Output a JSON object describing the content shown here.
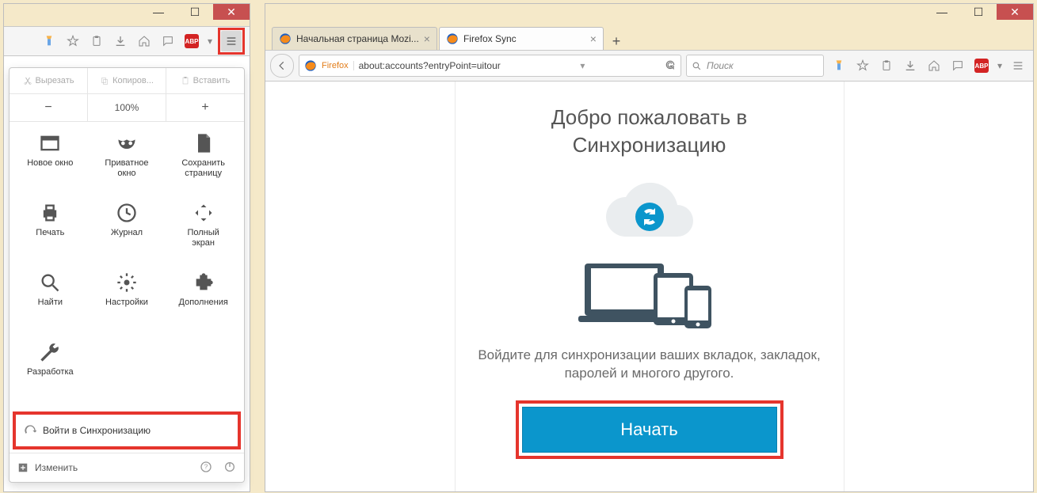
{
  "left": {
    "toolbar": {
      "abp": "ABP"
    },
    "menu": {
      "cut": "Вырезать",
      "copy": "Копиров...",
      "paste": "Вставить",
      "zoom": "100%",
      "items": [
        {
          "label": "Новое окно"
        },
        {
          "label": "Приватное\nокно"
        },
        {
          "label": "Сохранить\nстраницу"
        },
        {
          "label": "Печать"
        },
        {
          "label": "Журнал"
        },
        {
          "label": "Полный\nэкран"
        },
        {
          "label": "Найти"
        },
        {
          "label": "Настройки"
        },
        {
          "label": "Дополнения"
        },
        {
          "label": "Разработка"
        }
      ],
      "sync": "Войти в Синхронизацию",
      "customize": "Изменить"
    }
  },
  "right": {
    "tabs": [
      {
        "label": "Начальная страница Mozi..."
      },
      {
        "label": "Firefox Sync"
      }
    ],
    "url_prefix": "Firefox",
    "url": "about:accounts?entryPoint=uitour",
    "search_placeholder": "Поиск",
    "toolbar": {
      "abp": "ABP"
    },
    "page": {
      "title1": "Добро пожаловать в",
      "title2": "Синхронизацию",
      "desc": "Войдите для синхронизации ваших вкладок, закладок, паролей и многого другого.",
      "cta": "Начать"
    }
  }
}
